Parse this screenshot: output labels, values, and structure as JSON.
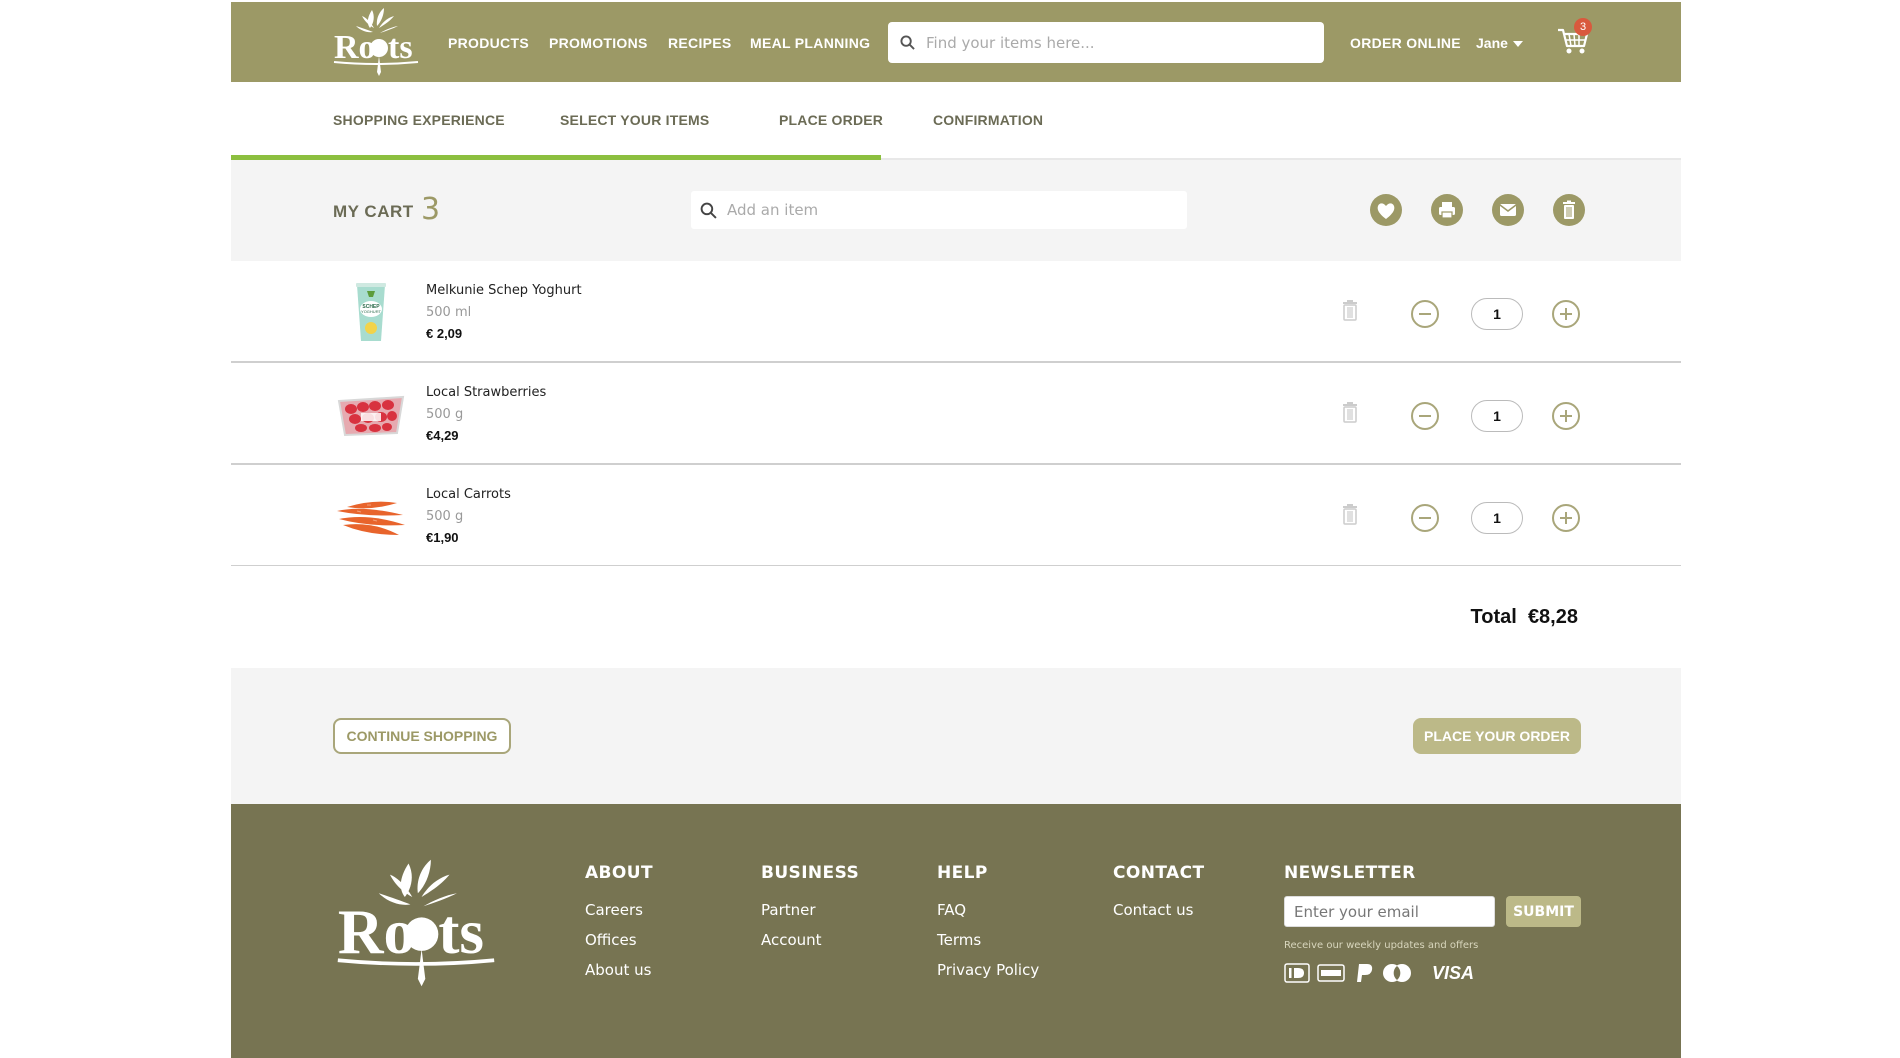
{
  "brand": {
    "name": "Roots"
  },
  "nav": {
    "links": [
      "PRODUCTS",
      "PROMOTIONS",
      "RECIPES",
      "MEAL PLANNING"
    ],
    "search_placeholder": "Find your items here...",
    "order_online": "ORDER ONLINE",
    "user": "Jane",
    "cart_count": "3"
  },
  "steps": {
    "items": [
      "SHOPPING EXPERIENCE",
      "SELECT YOUR ITEMS",
      "PLACE ORDER",
      "CONFIRMATION"
    ],
    "completed_through": "PLACE ORDER"
  },
  "cart": {
    "title": "MY CART",
    "count": "3",
    "add_placeholder": "Add an item",
    "actions": [
      "heart-icon",
      "print-icon",
      "mail-icon",
      "trash-icon"
    ],
    "items": [
      {
        "name": "Melkunie Schep Yoghurt",
        "size": "500 ml",
        "price": "€ 2,09",
        "qty": "1",
        "image": "yoghurt-cup"
      },
      {
        "name": "Local Strawberries",
        "size": "500 g",
        "price": "€4,29",
        "qty": "1",
        "image": "strawberry-punnet"
      },
      {
        "name": "Local Carrots",
        "size": "500 g",
        "price": "€1,90",
        "qty": "1",
        "image": "carrots"
      }
    ],
    "total_label": "Total",
    "total_value": "€8,28"
  },
  "buttons": {
    "continue": "CONTINUE SHOPPING",
    "place": "PLACE YOUR ORDER"
  },
  "footer": {
    "columns": [
      {
        "title": "ABOUT",
        "links": [
          "Careers",
          "Offices",
          "About us"
        ]
      },
      {
        "title": "BUSINESS",
        "links": [
          "Partner",
          "Account"
        ]
      },
      {
        "title": "HELP",
        "links": [
          "FAQ",
          "Terms",
          "Privacy Policy"
        ]
      },
      {
        "title": "CONTACT",
        "links": [
          "Contact us"
        ]
      }
    ],
    "newsletter": {
      "title": "NEWSLETTER",
      "placeholder": "Enter your email",
      "submit": "SUBMIT",
      "note": "Receive our weekly updates and offers"
    },
    "payments": [
      "ideal-icon",
      "amex-icon",
      "paypal-icon",
      "mastercard-icon",
      "VISA"
    ]
  },
  "colors": {
    "header": "#9c9966",
    "footer": "#777452",
    "accent_green": "#8cbf3f",
    "button": "#bcb988",
    "badge": "#d9593d"
  }
}
